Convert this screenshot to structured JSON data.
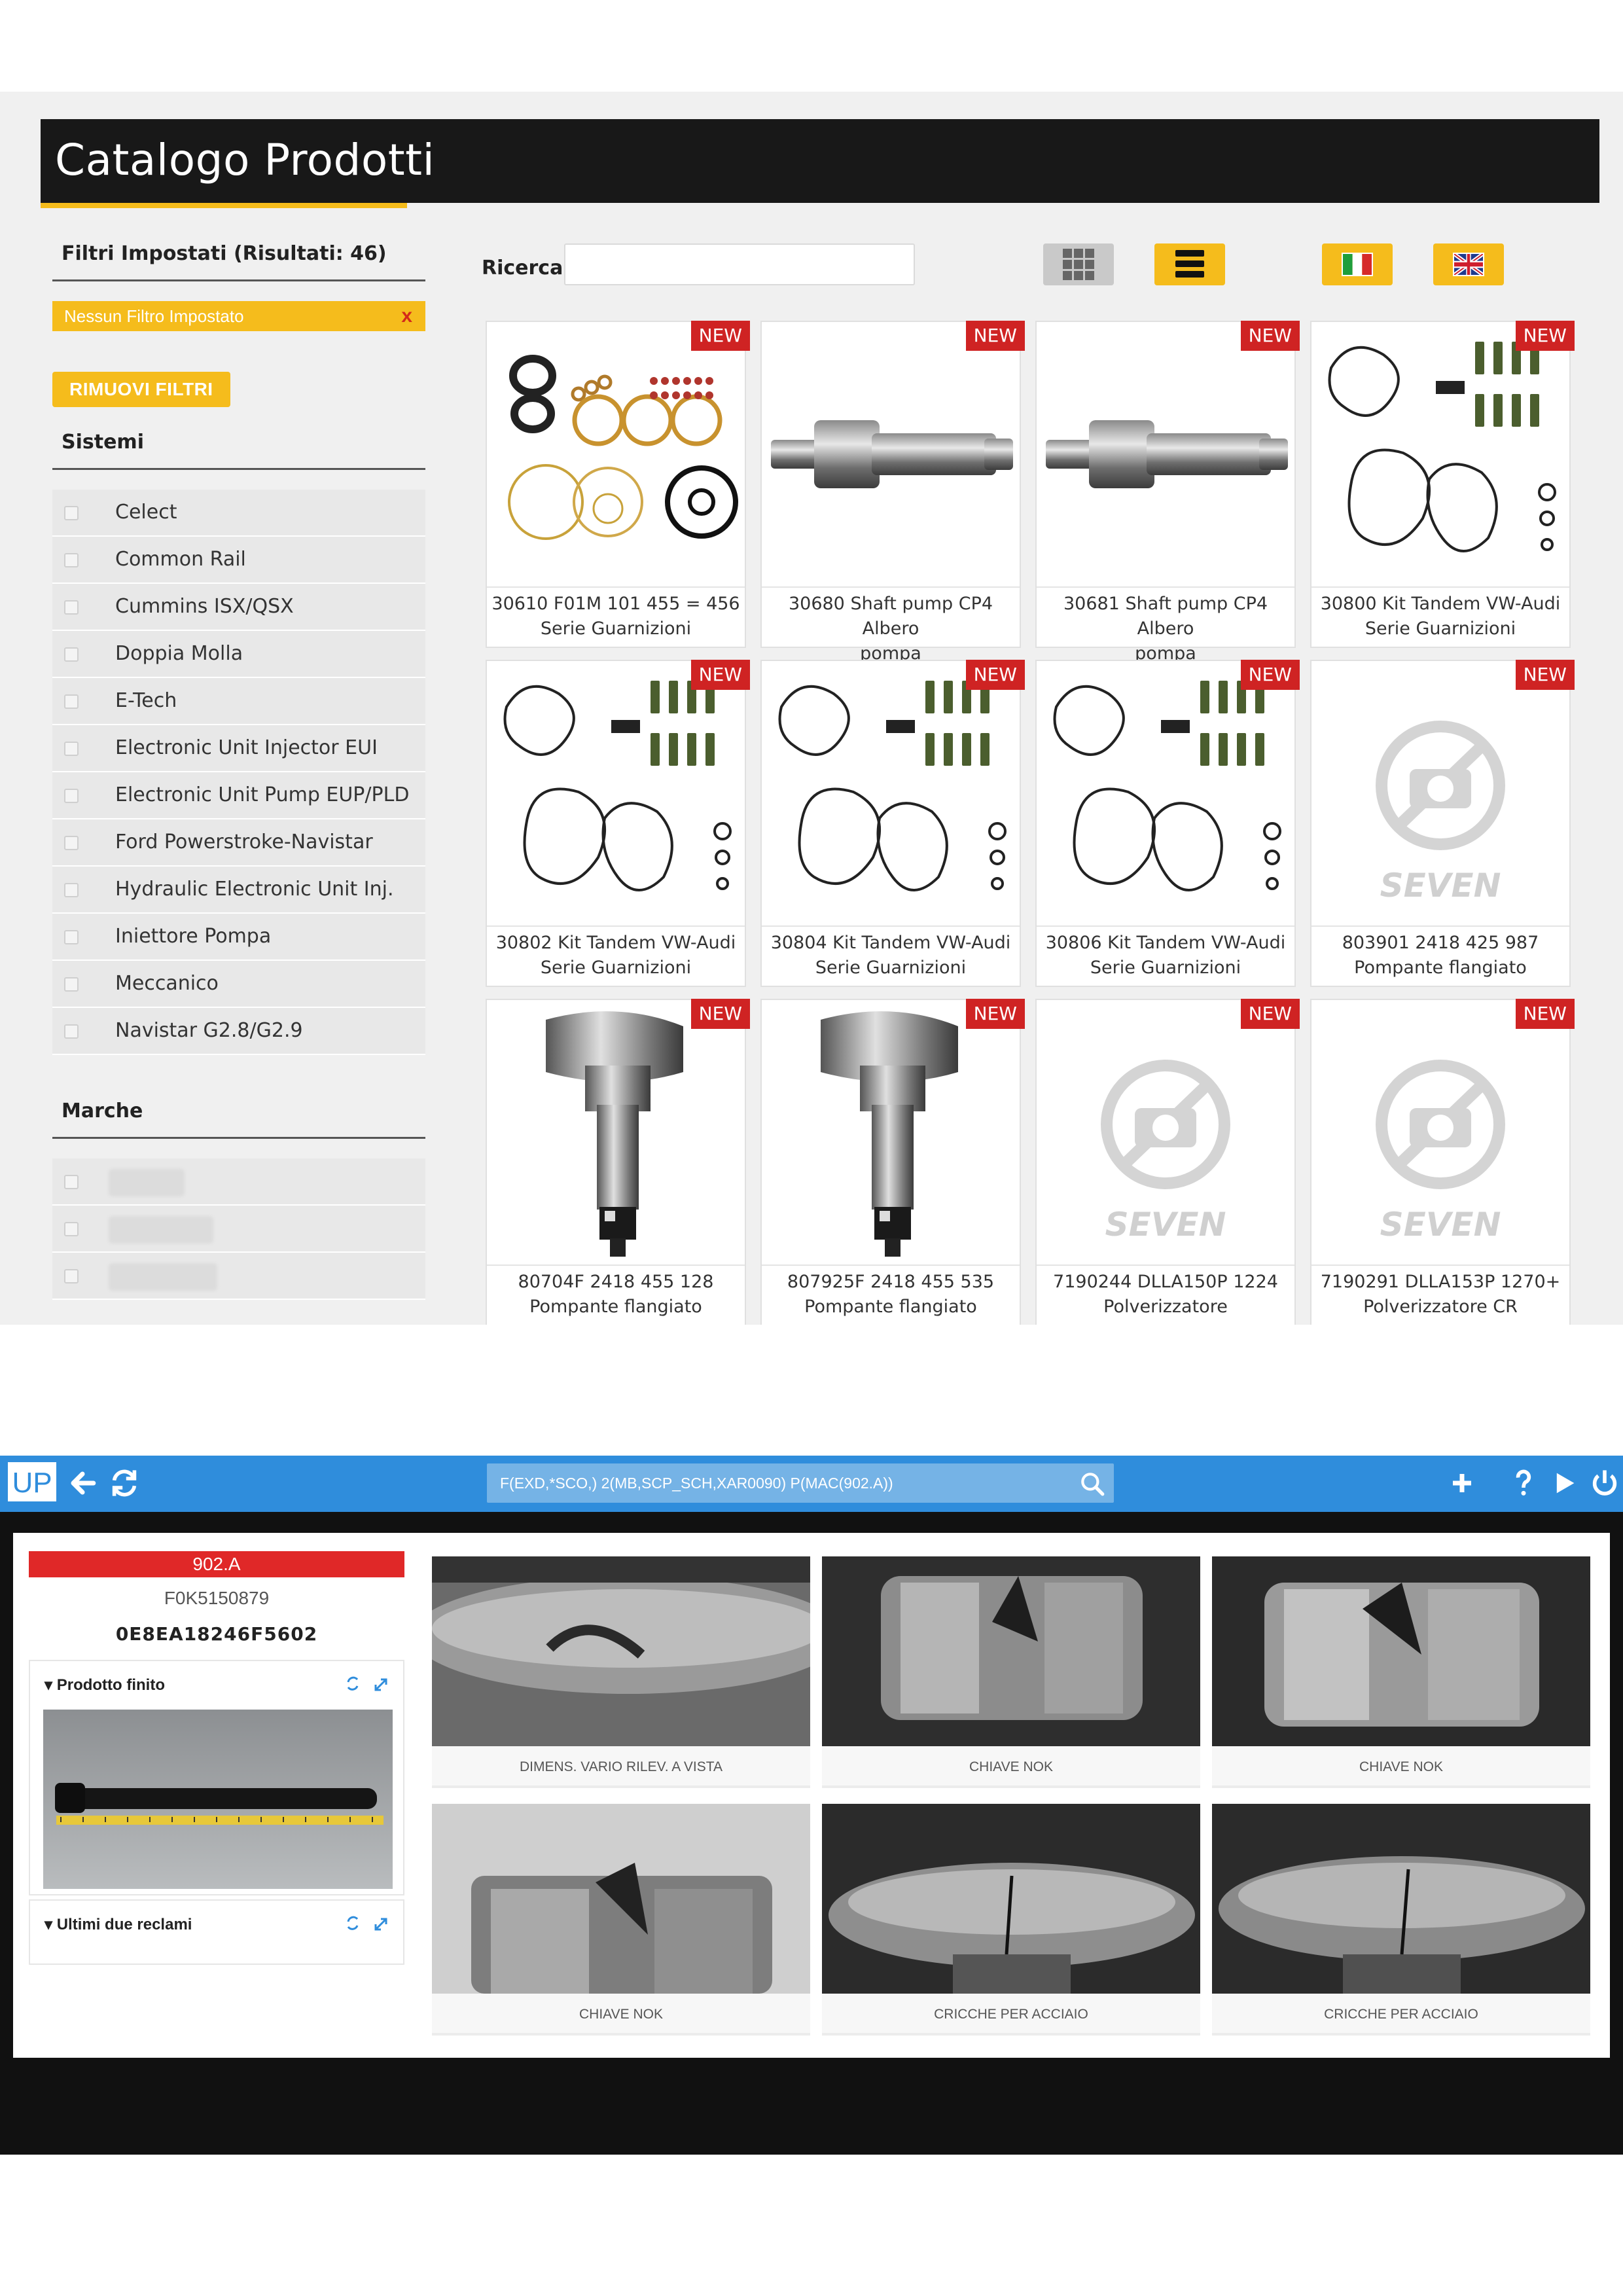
{
  "catalog": {
    "title": "Catalogo Prodotti",
    "filters_heading": "Filtri Impostati (Risultati: 46)",
    "no_filter": "Nessun Filtro Impostato",
    "no_filter_remove": "x",
    "remove_filters_button": "RIMUOVI FILTRI",
    "systems_heading": "Sistemi",
    "systems": [
      "Celect",
      "Common Rail",
      "Cummins ISX/QSX",
      "Doppia Molla",
      "E-Tech",
      "Electronic Unit Injector EUI",
      "Electronic Unit Pump EUP/PLD",
      "Ford Powerstroke-Navistar",
      "Hydraulic Electronic Unit Inj.",
      "Iniettore Pompa",
      "Meccanico",
      "Navistar G2.8/G2.9"
    ],
    "brands_heading": "Marche",
    "search_label": "Ricerca",
    "search_value": "",
    "accent_color": "#f5bc1c",
    "badge_color": "#cf2323",
    "new_badge": "NEW",
    "products": [
      {
        "line1": "30610 F01M 101 455 = 456",
        "line2": "Serie Guarnizioni",
        "image": "gasket-set"
      },
      {
        "line1": "30680 Shaft pump CP4 Albero",
        "line2": "pompa",
        "image": "shaft"
      },
      {
        "line1": "30681 Shaft pump CP4 Albero",
        "line2": "pompa",
        "image": "shaft"
      },
      {
        "line1": "30800 Kit Tandem VW-Audi",
        "line2": "Serie Guarnizioni",
        "image": "tandem-kit"
      },
      {
        "line1": "30802 Kit Tandem VW-Audi",
        "line2": "Serie Guarnizioni",
        "image": "tandem-kit"
      },
      {
        "line1": "30804 Kit Tandem VW-Audi",
        "line2": "Serie Guarnizioni",
        "image": "tandem-kit"
      },
      {
        "line1": "30806 Kit Tandem VW-Audi",
        "line2": "Serie Guarnizioni",
        "image": "tandem-kit"
      },
      {
        "line1": "803901 2418 425 987",
        "line2": "Pompante flangiato",
        "image": "placeholder"
      },
      {
        "line1": "80704F 2418 455 128",
        "line2": "Pompante flangiato",
        "image": "plunger"
      },
      {
        "line1": "807925F 2418 455 535",
        "line2": "Pompante flangiato",
        "image": "plunger"
      },
      {
        "line1": "7190244 DLLA150P 1224",
        "line2": "Polverizzatore",
        "image": "placeholder"
      },
      {
        "line1": "7190291 DLLA153P 1270+",
        "line2": "Polverizzatore CR",
        "image": "placeholder"
      }
    ],
    "placeholder_logo_text": "SEVEN"
  },
  "inspection": {
    "logo": "UP",
    "query": "F(EXD,*SCO,) 2(MB,SCP_SCH,XAR0090) P(MAC(902.A))",
    "code": "902.A",
    "part_number": "F0K5150879",
    "serial": "0E8EA18246F5602",
    "finished_product_label": "Prodotto finito",
    "last_claims_label": "Ultimi due reclami",
    "bar_color": "#2f8ddc",
    "code_color": "#e02828",
    "photos": [
      {
        "caption": "DIMENS. VARIO RILEV. A VISTA"
      },
      {
        "caption": "CHIAVE NOK"
      },
      {
        "caption": "CHIAVE NOK"
      },
      {
        "caption": "CHIAVE NOK"
      },
      {
        "caption": "CRICCHE PER ACCIAIO"
      },
      {
        "caption": "CRICCHE PER ACCIAIO"
      }
    ]
  }
}
